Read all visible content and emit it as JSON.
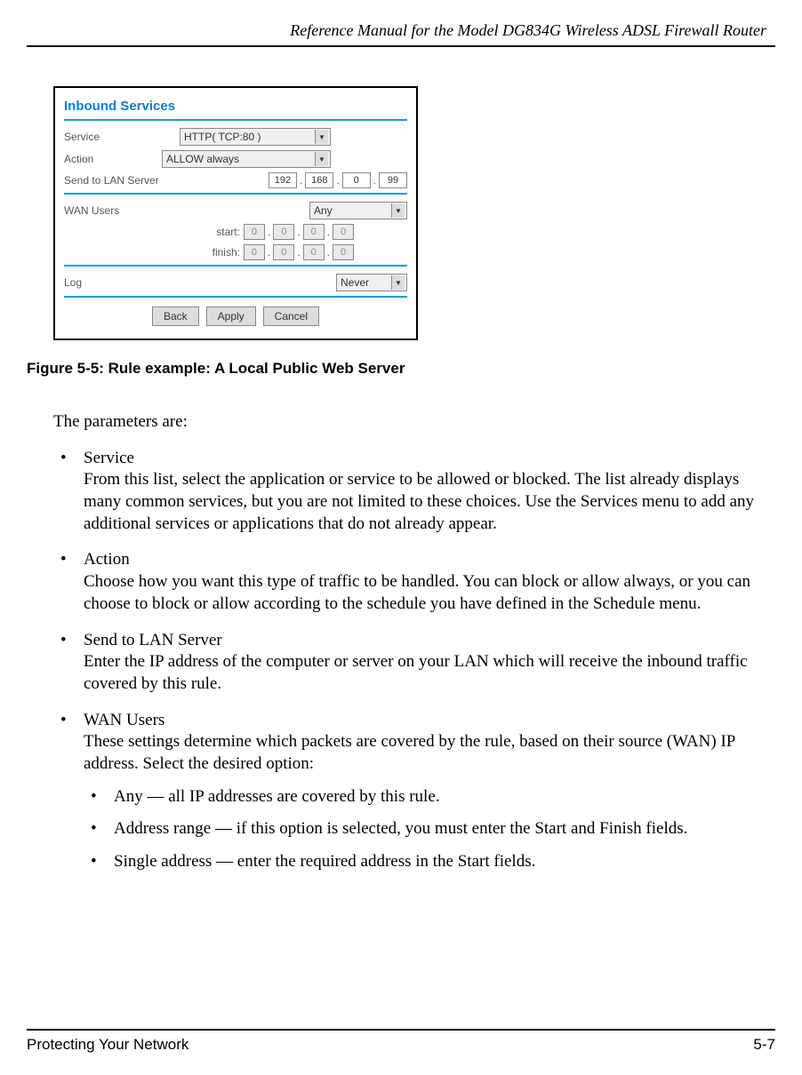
{
  "header": {
    "title": "Reference Manual for the Model DG834G Wireless ADSL Firewall Router"
  },
  "figure": {
    "heading": "Inbound Services",
    "service_label": "Service",
    "service_value": "HTTP( TCP:80 )",
    "action_label": "Action",
    "action_value": "ALLOW always",
    "lan_label": "Send to LAN Server",
    "lan_ip": [
      "192",
      "168",
      "0",
      "99"
    ],
    "wan_label": "WAN Users",
    "wan_value": "Any",
    "start_label": "start:",
    "finish_label": "finish:",
    "start_ip": [
      "0",
      "0",
      "0",
      "0"
    ],
    "finish_ip": [
      "0",
      "0",
      "0",
      "0"
    ],
    "log_label": "Log",
    "log_value": "Never",
    "buttons": {
      "back": "Back",
      "apply": "Apply",
      "cancel": "Cancel"
    }
  },
  "caption": {
    "prefix": "Figure 5-5:  Rule example: ",
    "title": "A Local Public Web Server"
  },
  "body": {
    "intro": "The parameters are:",
    "items": [
      {
        "title": "Service",
        "text": "From this list, select the application or service to be allowed or blocked. The list already displays many common services, but you are not limited to these choices. Use the Services menu to add any additional services or applications that do not already appear."
      },
      {
        "title": "Action",
        "text": "Choose how you want this type of traffic to be handled. You can block or allow always, or you can choose to block or allow according to the schedule you have defined in the Schedule menu."
      },
      {
        "title": "Send to LAN Server",
        "text": "Enter the IP address of the computer or server on your LAN which will receive the inbound traffic covered by this rule."
      },
      {
        "title": "WAN Users",
        "text": "These settings determine which packets are covered by the rule, based on their source (WAN) IP address. Select the desired option:"
      }
    ],
    "subitems": [
      "Any — all IP addresses are covered by this rule.",
      "Address range — if this option is selected, you must enter the Start and Finish fields.",
      "Single address — enter the required address in the Start fields."
    ]
  },
  "footer": {
    "left": "Protecting Your Network",
    "right": "5-7"
  }
}
